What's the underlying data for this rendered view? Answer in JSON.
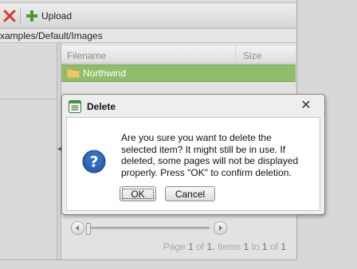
{
  "toolbar": {
    "upload_label": "Upload"
  },
  "path": {
    "text": "xamples/Default/Images"
  },
  "grid": {
    "columns": {
      "filename": "Filename",
      "size": "Size"
    },
    "rows": [
      {
        "name": "Northwind",
        "type": "folder",
        "selected": true
      }
    ]
  },
  "pager": {
    "page_label": "Page",
    "current_page": "1",
    "of_label": "of",
    "total_pages": "1.",
    "items_label": "Items",
    "item_from": "1",
    "to_label": "to",
    "item_to": "1",
    "of_label2": "of",
    "total_items": "1"
  },
  "dialog": {
    "title": "Delete",
    "message": "Are you sure you want to delete the selected item? It might still be in use. If deleted, some pages will not be displayed properly. Press \"OK\" to confirm deletion.",
    "ok_label": "OK",
    "cancel_label": "Cancel",
    "close_glyph": "✕"
  },
  "colors": {
    "selected_row": "#8fbd6a",
    "dialog_bg": "#eeeeee",
    "question_icon": "#2a5fb0",
    "delete_icon": "#d33",
    "upload_icon": "#4a9a3a"
  },
  "icons": [
    "delete-icon",
    "upload-icon",
    "folder-icon",
    "dialog-list-icon",
    "question-icon",
    "close-icon"
  ]
}
